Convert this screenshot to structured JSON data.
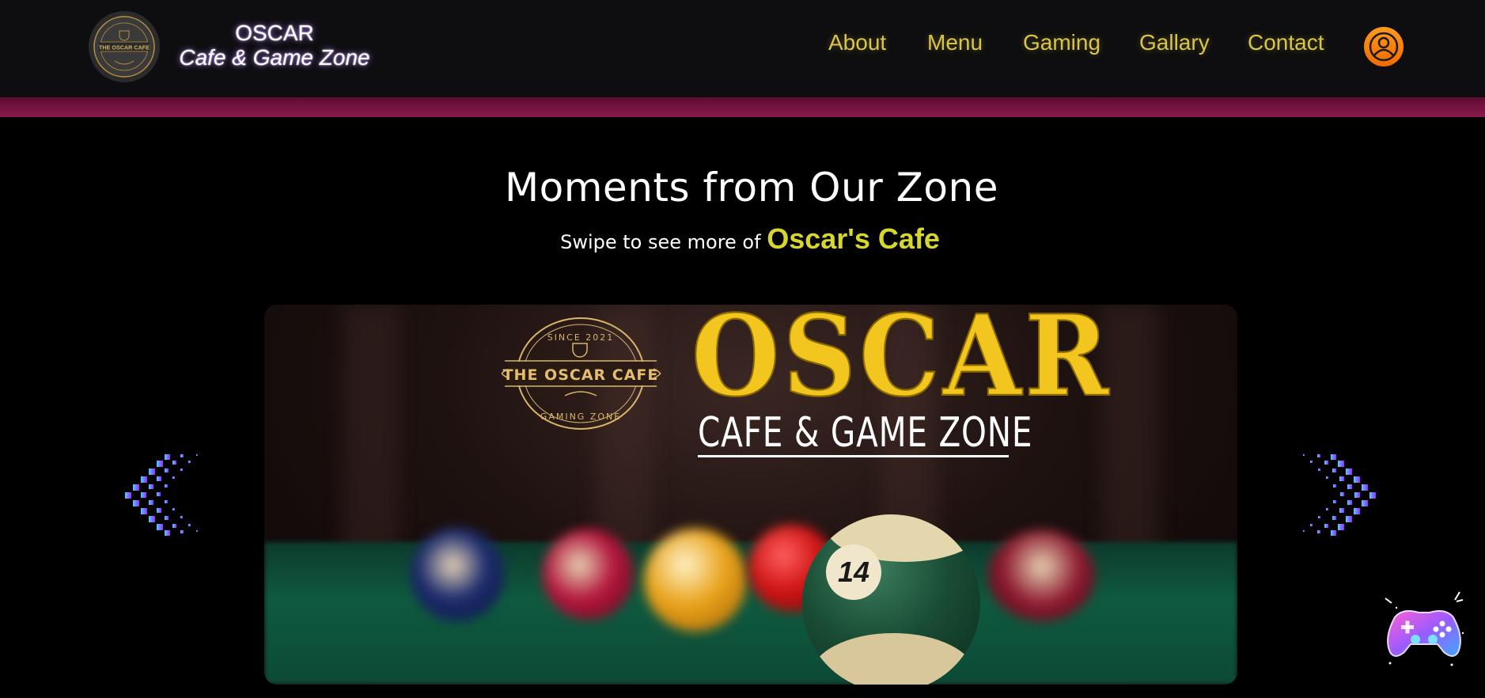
{
  "header": {
    "logo_text": "THE OSCAR CAFE",
    "brand_title": "OSCAR",
    "brand_subtitle": "Cafe & Game Zone",
    "nav": [
      {
        "label": "About"
      },
      {
        "label": "Menu"
      },
      {
        "label": "Gaming"
      },
      {
        "label": "Gallary"
      },
      {
        "label": "Contact"
      }
    ],
    "user_icon": "user-account-icon",
    "nav_color": "#d9c548",
    "band_color": "#7a1240"
  },
  "section": {
    "title": "Moments from Our Zone",
    "subtitle_prefix": "Swipe to see more of",
    "subtitle_highlight": "Oscar's Cafe",
    "highlight_color": "#d7d62a"
  },
  "slide": {
    "emblem_top": "SINCE 2021",
    "emblem_name": "THE OSCAR CAFE",
    "emblem_bottom": "GAMING ZONE",
    "headline": "OSCAR",
    "tagline": "CAFE & GAME ZONE",
    "ball_number": "14"
  },
  "controls": {
    "prev_icon": "chevron-left-pixel-icon",
    "next_icon": "chevron-right-pixel-icon",
    "floating_icon": "gamepad-icon"
  }
}
